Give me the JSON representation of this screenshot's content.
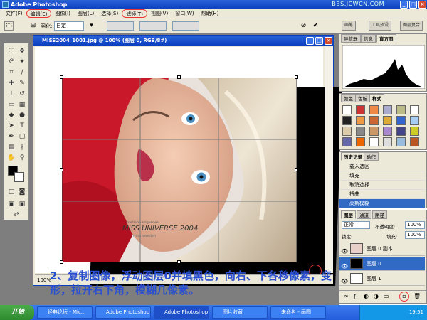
{
  "app": {
    "title": "Adobe Photoshop",
    "watermark": "BBS.JCWCN.COM",
    "window_controls": [
      "_",
      "□",
      "×"
    ]
  },
  "menu": [
    "文件(F)",
    "编辑(E)",
    "图像(I)",
    "图层(L)",
    "选择(S)",
    "滤镜(T)",
    "视图(V)",
    "窗口(W)",
    "帮助(H)"
  ],
  "options": {
    "feather_label": "羽化:",
    "style_value": "自定",
    "well_tabs": [
      "画笔",
      "工具预设",
      "图层复合"
    ]
  },
  "document": {
    "title": "MISS2004_1001.jpg @ 100% (图层 0, RGB/8#)",
    "zoom": "100%",
    "status": "文档:..."
  },
  "photo_text": {
    "credit": "costiano wigardes",
    "brand": "MISS UNIVERSE 2004",
    "sub": "miss sweden"
  },
  "caption": "2、复制图像，浮动图层0并填黑色，向右、下各移像素，变形，拉开右下角，模糊几像素。",
  "panels": {
    "navigator_tabs": [
      "导航器",
      "信息",
      "直方图"
    ],
    "swatch_tabs": [
      "颜色",
      "色板",
      "样式"
    ],
    "history": {
      "tabs": [
        "历史记录",
        "动作"
      ],
      "items": [
        "载入选区",
        "填充",
        "取消选择",
        "扭曲",
        "高斯模糊"
      ]
    },
    "layers": {
      "tabs": [
        "图层",
        "通道",
        "路径"
      ],
      "blend_mode": "正常",
      "opacity_label": "不透明度:",
      "opacity": "100%",
      "lock_label": "锁定:",
      "fill_label": "填充:",
      "fill": "100%",
      "rows": [
        "图层 0 副本",
        "图层 0",
        "图层 1"
      ]
    }
  },
  "taskbar": {
    "start": "开始",
    "tasks": [
      "经典论坛 - Mic...",
      "Adobe Photoshop",
      "Adobe Photoshop",
      "图片收藏",
      "未命名 - 画图"
    ],
    "time": "19:51"
  },
  "colors": {
    "caption": "#2a4fd0",
    "accent_red": "#e33333"
  }
}
